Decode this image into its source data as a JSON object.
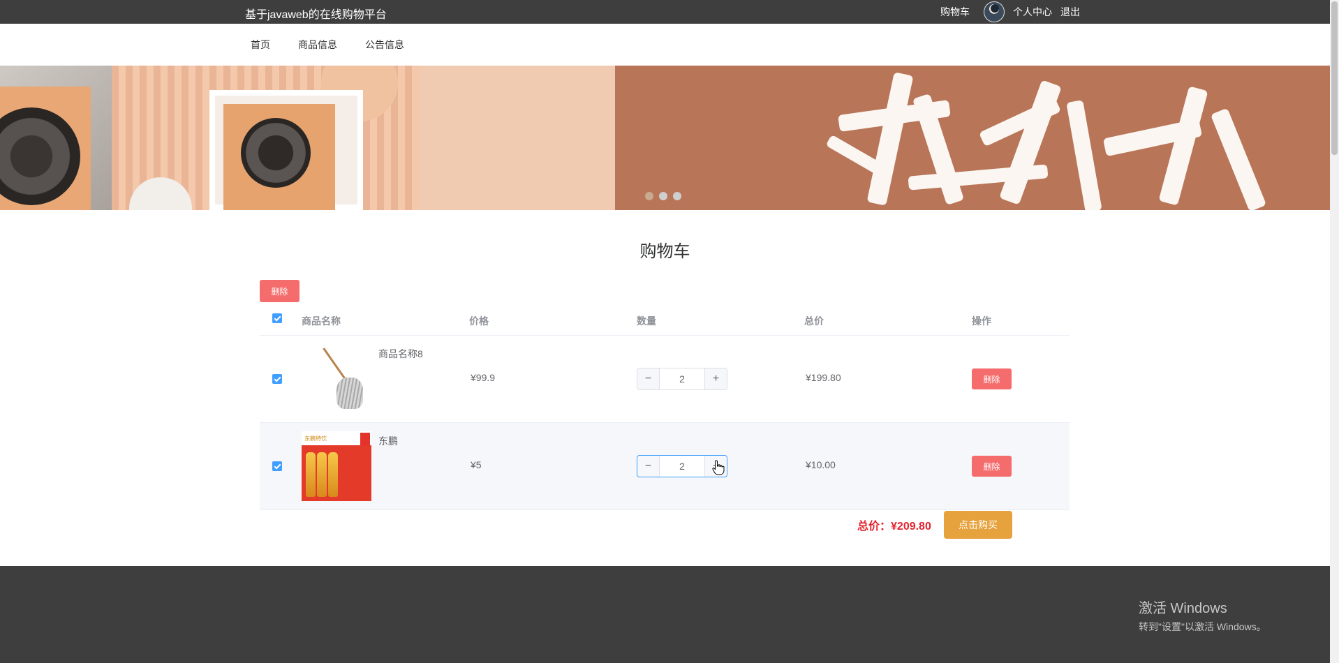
{
  "header": {
    "site_title": "基于javaweb的在线购物平台",
    "cart_link": "购物车",
    "profile_link": "个人中心",
    "logout_link": "退出"
  },
  "nav": {
    "items": [
      "首页",
      "商品信息",
      "公告信息"
    ]
  },
  "banner": {
    "dot_count": 3,
    "active_dot": 0
  },
  "cart": {
    "title": "购物车",
    "delete_selected_label": "删除",
    "columns": [
      "商品名称",
      "价格",
      "数量",
      "总价",
      "操作"
    ],
    "rows": [
      {
        "name": "商品名称8",
        "price": "¥99.9",
        "quantity": "2",
        "total": "¥199.80",
        "action": "删除",
        "checked": true,
        "image": "mop"
      },
      {
        "name": "东鹏",
        "price": "¥5",
        "quantity": "2",
        "total": "¥10.00",
        "action": "删除",
        "checked": true,
        "image": "drink-pack"
      }
    ],
    "summary_label": "总价：",
    "summary_value": "¥209.80",
    "buy_label": "点击购买"
  },
  "watermark": {
    "line1": "激活 Windows",
    "line2": "转到\"设置\"以激活 Windows。"
  },
  "colors": {
    "topbar": "#3e3e3e",
    "danger": "#f56c6c",
    "warning": "#e6a23c",
    "primary": "#409eff",
    "price_red": "#e4232e"
  }
}
